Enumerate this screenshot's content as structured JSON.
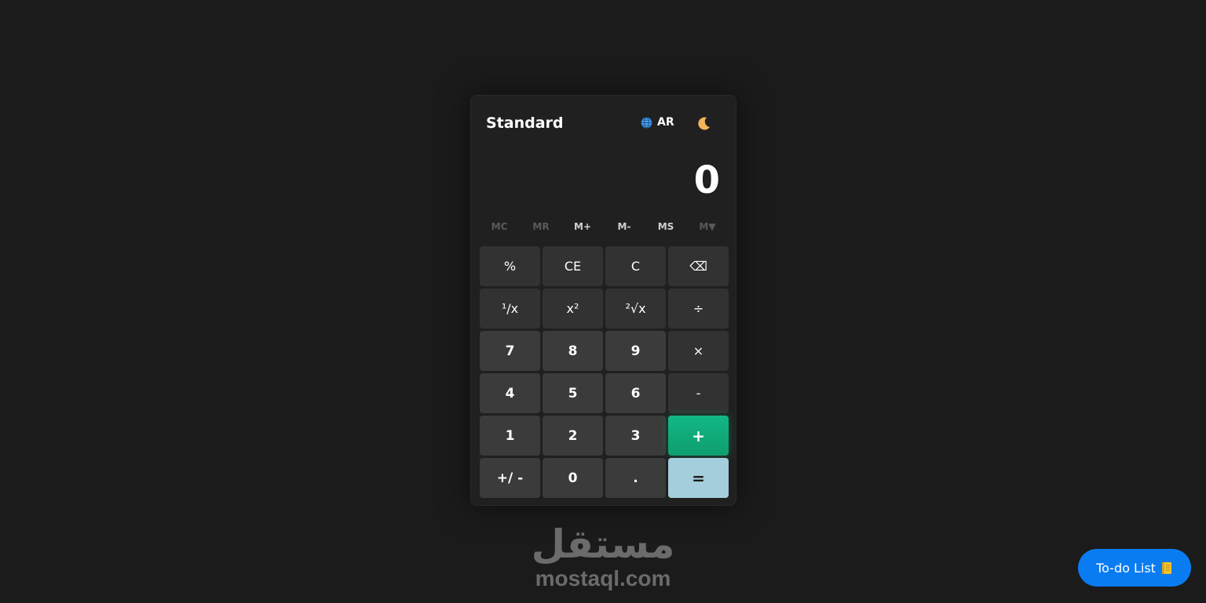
{
  "calculator": {
    "title": "Standard",
    "language_label": "AR",
    "display_value": "0",
    "memory": [
      {
        "label": "MC",
        "enabled": false
      },
      {
        "label": "MR",
        "enabled": false
      },
      {
        "label": "M+",
        "enabled": true
      },
      {
        "label": "M-",
        "enabled": true
      },
      {
        "label": "MS",
        "enabled": true
      },
      {
        "label": "M▼",
        "enabled": false
      }
    ],
    "keys": {
      "percent": "%",
      "ce": "CE",
      "c": "C",
      "backspace": "⌫",
      "reciprocal": "¹/x",
      "square": "x²",
      "sqrt": "²√x",
      "divide": "÷",
      "seven": "7",
      "eight": "8",
      "nine": "9",
      "multiply": "×",
      "four": "4",
      "five": "5",
      "six": "6",
      "minus": "-",
      "one": "1",
      "two": "2",
      "three": "3",
      "plus": "+",
      "negate": "+/ -",
      "zero": "0",
      "decimal": ".",
      "equals": "="
    },
    "colors": {
      "plus_accent": "#12b886",
      "equals_accent": "#a4cedb"
    }
  },
  "watermark": {
    "arabic": "مستقل",
    "latin": "mostaql.com"
  },
  "todo_button": {
    "label": "To-do List"
  },
  "icons": {
    "language": "globe-icon",
    "theme": "moon-icon",
    "todo": "notebook-icon"
  }
}
